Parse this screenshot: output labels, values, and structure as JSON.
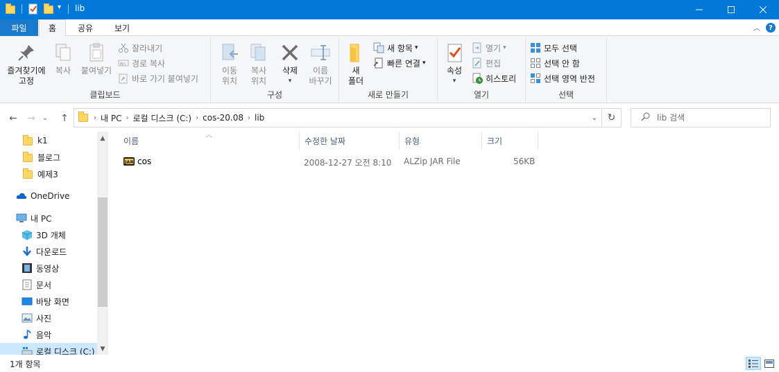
{
  "window": {
    "title": "lib"
  },
  "tabs": {
    "file": "파일",
    "home": "홈",
    "share": "공유",
    "view": "보기"
  },
  "ribbon": {
    "clipboard": {
      "label": "클립보드",
      "pin": "즐겨찾기에\n고정",
      "copy": "복사",
      "paste": "붙여넣기",
      "cut": "잘라내기",
      "copy_path": "경로 복사",
      "paste_shortcut": "바로 가기 붙여넣기"
    },
    "organize": {
      "label": "구성",
      "move_to": "이동\n위치",
      "copy_to": "복사\n위치",
      "delete": "삭제",
      "rename": "이름\n바꾸기"
    },
    "new": {
      "label": "새로 만들기",
      "new_folder": "새\n폴더",
      "new_item": "새 항목",
      "easy_access": "빠른 연결"
    },
    "open": {
      "label": "열기",
      "properties": "속성",
      "open": "열기",
      "edit": "편집",
      "history": "히스토리"
    },
    "select": {
      "label": "선택",
      "select_all": "모두 선택",
      "select_none": "선택 안 함",
      "invert_selection": "선택 영역 반전"
    }
  },
  "address": {
    "crumbs": [
      "내 PC",
      "로컬 디스크 (C:)",
      "cos-20.08",
      "lib"
    ],
    "search_placeholder": "lib 검색"
  },
  "nav": {
    "items": [
      {
        "label": "k1",
        "icon": "folder-icon"
      },
      {
        "label": "블로그",
        "icon": "folder-icon"
      },
      {
        "label": "예제3",
        "icon": "folder-icon"
      },
      {
        "label": "OneDrive",
        "icon": "cloud-icon"
      },
      {
        "label": "내 PC",
        "icon": "pc-icon"
      },
      {
        "label": "3D 개체",
        "icon": "cube-icon"
      },
      {
        "label": "다운로드",
        "icon": "download-icon"
      },
      {
        "label": "동영상",
        "icon": "video-icon"
      },
      {
        "label": "문서",
        "icon": "document-icon"
      },
      {
        "label": "바탕 화면",
        "icon": "desktop-icon"
      },
      {
        "label": "사진",
        "icon": "picture-icon"
      },
      {
        "label": "음악",
        "icon": "music-icon"
      },
      {
        "label": "로컬 디스크 (C:)",
        "icon": "drive-icon"
      }
    ]
  },
  "columns": {
    "name": "이름",
    "modified": "수정한 날짜",
    "type": "유형",
    "size": "크기"
  },
  "files": [
    {
      "name": "cos",
      "modified": "2008-12-27 오전 8:10",
      "type": "ALZip JAR File",
      "size": "56KB",
      "icon": "jar-icon"
    }
  ],
  "status": {
    "count": "1개 항목"
  },
  "colors": {
    "titlebar": "#0078d7",
    "file_tab": "#1979ca",
    "selection": "#cce8ff"
  }
}
